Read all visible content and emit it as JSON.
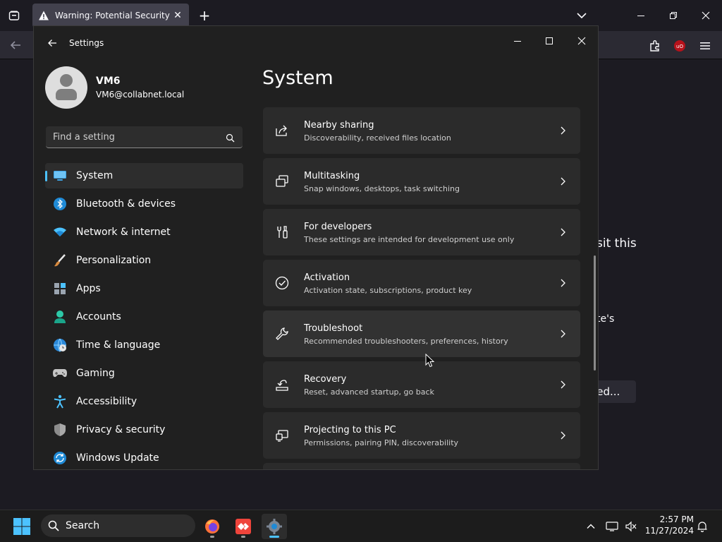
{
  "browser": {
    "tab_title": "Warning: Potential Security Risk Ahead",
    "page_partial_text_1": "sit this",
    "page_partial_text_2": "te's",
    "page_partial_button": "ced..."
  },
  "settings": {
    "window_title": "Settings",
    "profile": {
      "name": "VM6",
      "email": "VM6@collabnet.local"
    },
    "search_placeholder": "Find a setting",
    "nav": [
      {
        "label": "System",
        "icon": "system-icon",
        "selected": true
      },
      {
        "label": "Bluetooth & devices",
        "icon": "bluetooth-icon"
      },
      {
        "label": "Network & internet",
        "icon": "wifi-icon"
      },
      {
        "label": "Personalization",
        "icon": "brush-icon"
      },
      {
        "label": "Apps",
        "icon": "apps-icon"
      },
      {
        "label": "Accounts",
        "icon": "person-icon"
      },
      {
        "label": "Time & language",
        "icon": "globe-clock-icon"
      },
      {
        "label": "Gaming",
        "icon": "gamepad-icon"
      },
      {
        "label": "Accessibility",
        "icon": "accessibility-icon"
      },
      {
        "label": "Privacy & security",
        "icon": "shield-icon"
      },
      {
        "label": "Windows Update",
        "icon": "update-icon"
      }
    ],
    "page_title": "System",
    "cards": [
      {
        "title": "Nearby sharing",
        "desc": "Discoverability, received files location",
        "icon": "share-icon"
      },
      {
        "title": "Multitasking",
        "desc": "Snap windows, desktops, task switching",
        "icon": "multitasking-icon"
      },
      {
        "title": "For developers",
        "desc": "These settings are intended for development use only",
        "icon": "developer-tools-icon"
      },
      {
        "title": "Activation",
        "desc": "Activation state, subscriptions, product key",
        "icon": "check-circle-icon"
      },
      {
        "title": "Troubleshoot",
        "desc": "Recommended troubleshooters, preferences, history",
        "icon": "wrench-icon"
      },
      {
        "title": "Recovery",
        "desc": "Reset, advanced startup, go back",
        "icon": "recovery-icon"
      },
      {
        "title": "Projecting to this PC",
        "desc": "Permissions, pairing PIN, discoverability",
        "icon": "projecting-icon"
      }
    ]
  },
  "taskbar": {
    "search_label": "Search",
    "time": "2:57 PM",
    "date": "11/27/2024"
  },
  "colors": {
    "accent": "#4cc2ff",
    "window_bg": "#202020",
    "card_bg": "#2b2b2b"
  }
}
